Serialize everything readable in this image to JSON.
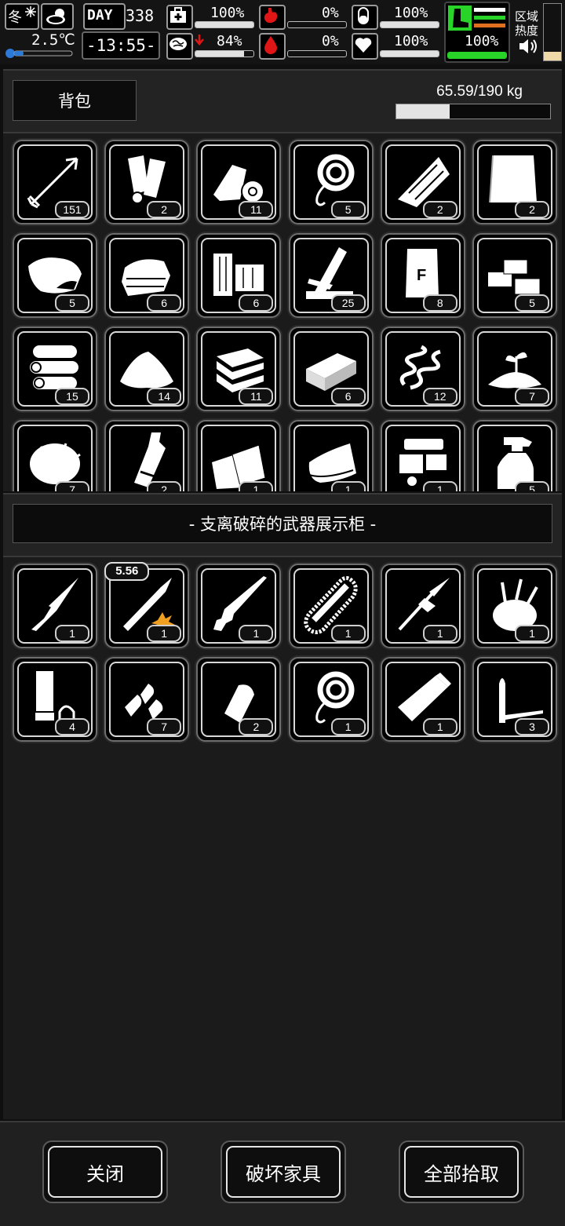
{
  "hud": {
    "season": "冬",
    "temperature": "2.5℃",
    "day_label": "DAY",
    "day_number": "338",
    "time": "-13:55-",
    "health_pct": "100%",
    "mental_pct": "84%",
    "hunger_pct": "0%",
    "thirst_pct": "0%",
    "sleep_pct": "100%",
    "mood_pct": "100%",
    "stamina_pct": "100%",
    "zone_heat_label_1": "区域",
    "zone_heat_label_2": "热度",
    "bars": {
      "health": 1.0,
      "mental": 0.84,
      "hunger": 0.0,
      "thirst": 0.0,
      "sleep": 1.0,
      "mood": 1.0,
      "stamina": 1.0,
      "zone_heat": 0.15
    },
    "accent_green": "#29d429",
    "accent_red": "#e01515",
    "accent_orange": "#e07020"
  },
  "backpack": {
    "title": "背包",
    "weight": "65.59/190 kg",
    "weight_fraction": 0.3452,
    "items": [
      {
        "icon": "arrow-icon",
        "count": "151"
      },
      {
        "icon": "cloth-rolls-icon",
        "count": "2"
      },
      {
        "icon": "bandage-icon",
        "count": "11"
      },
      {
        "icon": "rope-icon",
        "count": "5"
      },
      {
        "icon": "wood-planks-icon",
        "count": "2"
      },
      {
        "icon": "cloth-sheet-icon",
        "count": "2"
      },
      {
        "icon": "meat-icon",
        "count": "5"
      },
      {
        "icon": "folded-clothes-icon",
        "count": "6"
      },
      {
        "icon": "wood-blocks-icon",
        "count": "6"
      },
      {
        "icon": "lumber-icon",
        "count": "25"
      },
      {
        "icon": "fertilizer-bag-icon",
        "count": "8"
      },
      {
        "icon": "bricks-icon",
        "count": "5"
      },
      {
        "icon": "logs-icon",
        "count": "15"
      },
      {
        "icon": "sand-pile-icon",
        "count": "14"
      },
      {
        "icon": "stone-slabs-icon",
        "count": "11"
      },
      {
        "icon": "cement-block-icon",
        "count": "6"
      },
      {
        "icon": "spring-icon",
        "count": "12"
      },
      {
        "icon": "seedling-soil-icon",
        "count": "7"
      },
      {
        "icon": "fur-ball-icon",
        "count": "7"
      },
      {
        "icon": "bottle-icon",
        "count": "2"
      },
      {
        "icon": "paper-sheets-icon",
        "count": "1"
      },
      {
        "icon": "blanket-icon",
        "count": "1"
      },
      {
        "icon": "mechanical-parts-icon",
        "count": "1"
      },
      {
        "icon": "spray-bottle-icon",
        "count": "5"
      }
    ]
  },
  "container": {
    "title": "- 支离破碎的武器展示柜 -",
    "items": [
      {
        "icon": "knife-icon",
        "count": "1",
        "tag": ""
      },
      {
        "icon": "bullet-icon",
        "count": "1",
        "tag": "5.56"
      },
      {
        "icon": "shotgun-icon",
        "count": "1",
        "tag": ""
      },
      {
        "icon": "chainsaw-blade-icon",
        "count": "1",
        "tag": ""
      },
      {
        "icon": "spear-icon",
        "count": "1",
        "tag": ""
      },
      {
        "icon": "tool-pouch-icon",
        "count": "1",
        "tag": ""
      },
      {
        "icon": "shell-casing-icon",
        "count": "4",
        "tag": ""
      },
      {
        "icon": "bullet-tips-icon",
        "count": "7",
        "tag": ""
      },
      {
        "icon": "bullet-head-icon",
        "count": "2",
        "tag": ""
      },
      {
        "icon": "rope-icon",
        "count": "1",
        "tag": ""
      },
      {
        "icon": "casing-icon",
        "count": "1",
        "tag": ""
      },
      {
        "icon": "cartridge-icon",
        "count": "3",
        "tag": ""
      }
    ]
  },
  "buttons": {
    "close": "关闭",
    "destroy": "破坏家具",
    "take_all": "全部拾取"
  }
}
